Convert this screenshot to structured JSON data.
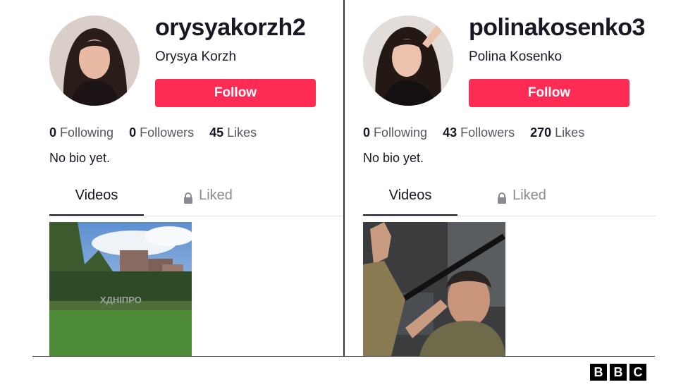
{
  "profiles": [
    {
      "username": "orysyakorzh2",
      "display_name": "Orysya Korzh",
      "follow_label": "Follow",
      "stats": [
        {
          "value": "0",
          "label": "Following"
        },
        {
          "value": "0",
          "label": "Followers"
        },
        {
          "value": "45",
          "label": "Likes"
        }
      ],
      "bio": "No bio yet.",
      "tabs": {
        "videos": "Videos",
        "liked": "Liked"
      },
      "video_overlay_text": "ХДНІПРО"
    },
    {
      "username": "polinakosenko3",
      "display_name": "Polina Kosenko",
      "follow_label": "Follow",
      "stats": [
        {
          "value": "0",
          "label": "Following"
        },
        {
          "value": "43",
          "label": "Followers"
        },
        {
          "value": "270",
          "label": "Likes"
        }
      ],
      "bio": "No bio yet.",
      "tabs": {
        "videos": "Videos",
        "liked": "Liked"
      }
    }
  ],
  "watermark": [
    "B",
    "B",
    "C"
  ],
  "colors": {
    "follow_button": "#fe2c55",
    "text": "#161823",
    "muted": "#8a8b91"
  },
  "icons": {
    "liked_tab": "lock-icon"
  }
}
